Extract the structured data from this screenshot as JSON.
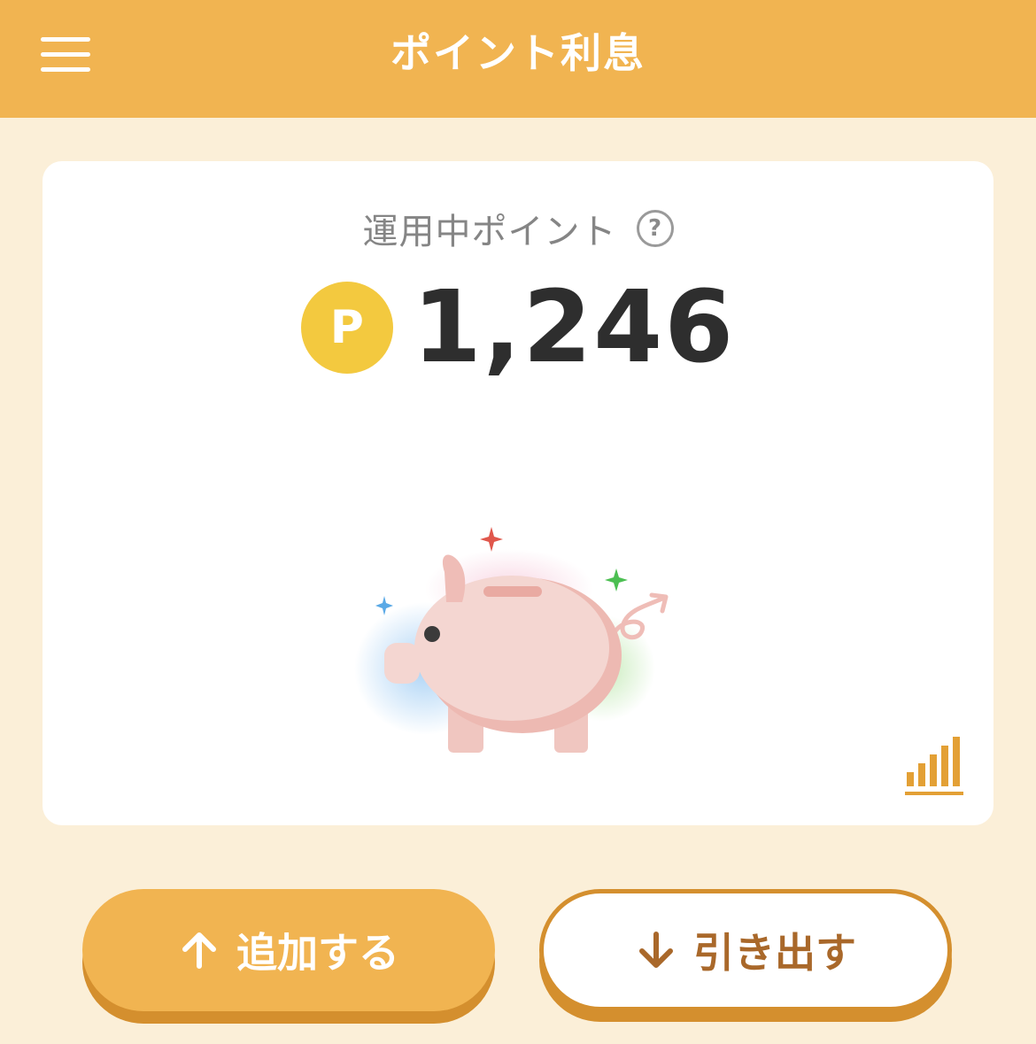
{
  "header": {
    "title": "ポイント利息"
  },
  "card": {
    "label": "運用中ポイント",
    "help_symbol": "?",
    "coin_symbol": "P",
    "points": "1,246"
  },
  "buttons": {
    "add_label": "追加する",
    "withdraw_label": "引き出す"
  },
  "colors": {
    "header": "#f1b451",
    "background": "#fbefd8",
    "coin": "#f3c93f",
    "accent_dark": "#d48f2e",
    "withdraw_text": "#a9682a"
  },
  "icons": [
    "menu-icon",
    "help-icon",
    "coin-icon",
    "piggy-bank-illustration",
    "bar-chart-icon",
    "arrow-up-icon",
    "arrow-down-icon"
  ]
}
